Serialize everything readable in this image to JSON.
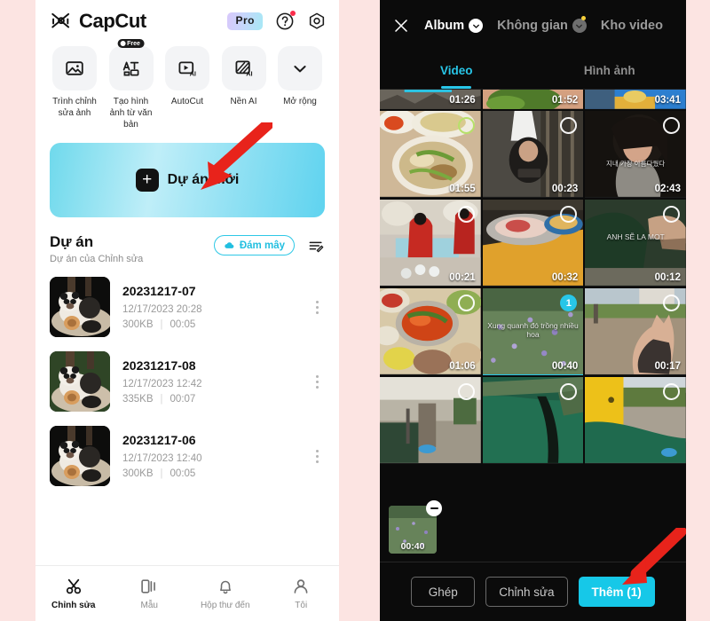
{
  "theme": {
    "page_bg": "#fce4e2",
    "accent_cyan": "#22bfe0",
    "dark_bg": "#0b0b0b",
    "arrow_red": "#e8231b"
  },
  "left_app": {
    "brand_name": "CapCut",
    "brand_logo_icon": "capcut-logo-icon",
    "header": {
      "pro_label": "Pro",
      "help_icon": "help-circle-icon",
      "settings_icon": "gear-icon"
    },
    "features": [
      {
        "label": "Trình chỉnh sửa ảnh",
        "icon": "image-edit-icon",
        "badge": ""
      },
      {
        "label": "Tạo hình ảnh từ văn bản",
        "icon": "text-to-image-icon",
        "badge": "Free"
      },
      {
        "label": "AutoCut",
        "icon": "auto-cut-ai-icon",
        "badge": ""
      },
      {
        "label": "Nền AI",
        "icon": "ai-background-icon",
        "badge": ""
      },
      {
        "label": "Mở rộng",
        "icon": "chevron-down-icon",
        "badge": ""
      }
    ],
    "banner": {
      "label": "Dự án mới",
      "plus_icon": "plus-icon"
    },
    "projects_section": {
      "title": "Dự án",
      "subtitle": "Dự án của Chỉnh sửa",
      "cloud_button_label": "Đám mây",
      "cloud_icon": "cloud-icon",
      "sort_icon": "sort-edit-icon"
    },
    "projects": [
      {
        "name": "20231217-07",
        "date": "12/17/2023 20:28",
        "size": "300KB",
        "duration": "00:05",
        "menu_icon": "more-vertical-icon"
      },
      {
        "name": "20231217-08",
        "date": "12/17/2023 12:42",
        "size": "335KB",
        "duration": "00:07",
        "menu_icon": "more-vertical-icon"
      },
      {
        "name": "20231217-06",
        "date": "12/17/2023 12:40",
        "size": "300KB",
        "duration": "00:05",
        "menu_icon": "more-vertical-icon"
      }
    ],
    "bottom_nav": [
      {
        "label": "Chỉnh sửa",
        "icon": "scissors-icon",
        "active": true
      },
      {
        "label": "Mẫu",
        "icon": "template-icon",
        "active": false
      },
      {
        "label": "Hộp thư đến",
        "icon": "bell-icon",
        "active": false
      },
      {
        "label": "Tôi",
        "icon": "person-icon",
        "active": false
      }
    ]
  },
  "right_app": {
    "topbar": {
      "close_icon": "close-icon",
      "tabs": [
        {
          "label": "Album",
          "active": true,
          "chevron": "chevron-down-icon",
          "chevron_style": "light",
          "dot": false
        },
        {
          "label": "Không gian",
          "active": false,
          "chevron": "chevron-down-icon",
          "chevron_style": "grey",
          "dot": true
        },
        {
          "label": "Kho video",
          "active": false,
          "chevron": "",
          "chevron_style": "",
          "dot": false
        }
      ]
    },
    "media_tabs": [
      {
        "label": "Video",
        "active": true
      },
      {
        "label": "Hình ảnh",
        "active": false
      }
    ],
    "grid_rows": [
      {
        "partial": true,
        "cells": [
          {
            "duration": "01:26",
            "selected": false,
            "checkbox": false,
            "caption": "",
            "art": "rocks-grey"
          },
          {
            "duration": "01:52",
            "selected": false,
            "checkbox": false,
            "caption": "",
            "art": "herbs-green"
          },
          {
            "duration": "03:41",
            "selected": false,
            "checkbox": false,
            "caption": "",
            "art": "stage-blue"
          }
        ]
      },
      {
        "partial": false,
        "cells": [
          {
            "duration": "01:55",
            "selected": false,
            "checkbox": true,
            "checkbox_green": true,
            "caption": "",
            "art": "noodle-bowl"
          },
          {
            "duration": "00:23",
            "selected": false,
            "checkbox": true,
            "caption": "",
            "art": "girl-street"
          },
          {
            "duration": "02:43",
            "selected": false,
            "checkbox": true,
            "caption": "지내 가장 아름다웠다",
            "art": "drama-girl"
          }
        ]
      },
      {
        "partial": false,
        "cells": [
          {
            "duration": "00:21",
            "selected": false,
            "checkbox": true,
            "caption": "",
            "art": "wedding-red"
          },
          {
            "duration": "00:32",
            "selected": false,
            "checkbox": true,
            "caption": "",
            "art": "fish-tray"
          },
          {
            "duration": "00:12",
            "selected": false,
            "checkbox": true,
            "caption": "ANH SẼ LA MOT",
            "art": "green-sleeve"
          }
        ]
      },
      {
        "partial": false,
        "cells": [
          {
            "duration": "01:06",
            "selected": false,
            "checkbox": true,
            "caption": "",
            "art": "hotpot"
          },
          {
            "duration": "00:40",
            "selected": true,
            "checkbox": true,
            "badge": "1",
            "caption": "Xung quanh đó trồng nhiều hoa",
            "art": "flower-field"
          },
          {
            "duration": "00:17",
            "selected": false,
            "checkbox": true,
            "caption": "",
            "art": "hand-road"
          }
        ]
      },
      {
        "partial": false,
        "cells": [
          {
            "duration": "",
            "selected": false,
            "checkbox": true,
            "caption": "",
            "art": "beach-boat"
          },
          {
            "duration": "",
            "selected": false,
            "checkbox": true,
            "caption": "",
            "art": "green-seat"
          },
          {
            "duration": "",
            "selected": false,
            "checkbox": true,
            "caption": "",
            "art": "yellow-bus"
          }
        ]
      }
    ],
    "tray": {
      "items": [
        {
          "duration": "00:40",
          "remove_icon": "minus-circle-icon",
          "art": "flower-field"
        }
      ]
    },
    "actions": [
      {
        "label": "Ghép",
        "primary": false
      },
      {
        "label": "Chỉnh sửa",
        "primary": false
      },
      {
        "label": "Thêm (1)",
        "primary": true
      }
    ]
  },
  "annotations": [
    {
      "name": "arrow-to-new-project",
      "target": "Dự án mới"
    },
    {
      "name": "arrow-to-add-button",
      "target": "Thêm (1)"
    }
  ]
}
